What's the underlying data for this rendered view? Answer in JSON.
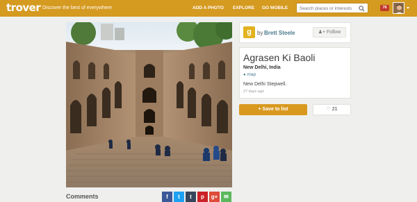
{
  "header": {
    "logo": "trover",
    "tagline": "Discover the best of everywhere",
    "nav": [
      "ADD A PHOTO",
      "EXPLORE",
      "GO MOBILE"
    ],
    "search_placeholder": "Search places or interests",
    "notification_count": "76",
    "brand_color": "#d59a20"
  },
  "owner": {
    "avatar_letter": "g",
    "by_label": "by",
    "name": "Brett Steele",
    "follow_label": "Follow"
  },
  "place": {
    "title": "Agrasen Ki Baoli",
    "location": "New Delhi, India",
    "map_label": "map",
    "description": "New Delhi Stepwell.",
    "time_ago": "27 days ago"
  },
  "actions": {
    "save_label": "+ Save to list",
    "likes_count": "21"
  },
  "comments": {
    "heading": "Comments"
  },
  "share": [
    {
      "name": "facebook",
      "glyph": "f",
      "color": "#3b5998"
    },
    {
      "name": "twitter",
      "glyph": "t",
      "color": "#1da1f2"
    },
    {
      "name": "tumblr",
      "glyph": "t",
      "color": "#35465c"
    },
    {
      "name": "pinterest",
      "glyph": "p",
      "color": "#cb2027"
    },
    {
      "name": "google-plus",
      "glyph": "g+",
      "color": "#dd4b39"
    },
    {
      "name": "email",
      "glyph": "✉",
      "color": "#5cb85c"
    }
  ]
}
